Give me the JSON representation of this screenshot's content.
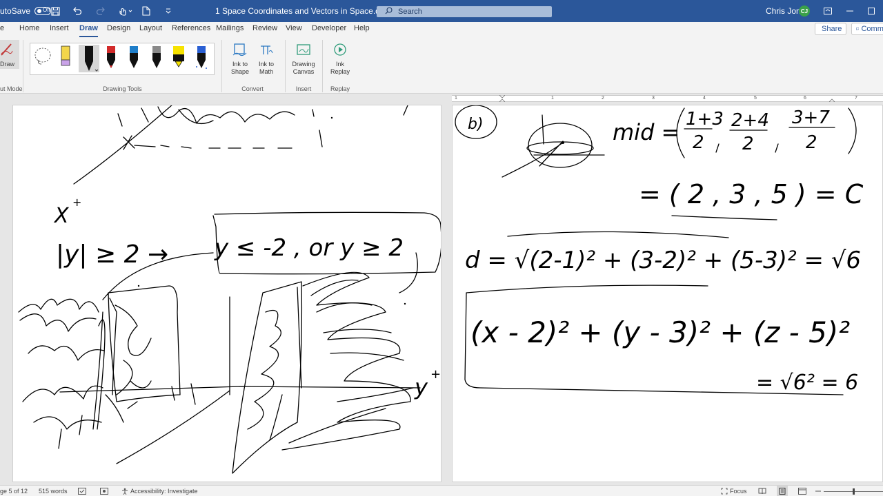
{
  "titlebar": {
    "autosave_label": "utoSave",
    "autosave_state": "Off",
    "doc_title": "1 Space Coordinates and Vectors in Space.docx",
    "search_placeholder": "Search",
    "user_name": "Chris Jones",
    "user_initials": "CJ",
    "icons": [
      "save-icon",
      "undo-icon",
      "redo-icon",
      "touch-mode-icon",
      "new-document-icon",
      "customize-toolbar-icon",
      "ribbon-display-icon",
      "minimize-icon",
      "restore-icon"
    ]
  },
  "tabs": {
    "items": [
      "e",
      "Home",
      "Insert",
      "Draw",
      "Design",
      "Layout",
      "References",
      "Mailings",
      "Review",
      "View",
      "Developer",
      "Help"
    ],
    "active": "Draw",
    "share_label": "Share",
    "comments_label": "Comme"
  },
  "ribbon": {
    "draw_label": "Draw",
    "mode_label": "ut Mode",
    "drawing_tools_label": "Drawing Tools",
    "convert_label": "Convert",
    "insert_label": "Insert",
    "replay_label": "Replay",
    "ink_to_shape_l1": "Ink to",
    "ink_to_shape_l2": "Shape",
    "ink_to_math_l1": "Ink to",
    "ink_to_math_l2": "Math",
    "drawing_canvas_l1": "Drawing",
    "drawing_canvas_l2": "Canvas",
    "ink_replay_l1": "Ink",
    "ink_replay_l2": "Replay",
    "pen_colors": [
      "#f2d64b",
      "#111111",
      "#d22a2a",
      "#1f7ec9",
      "#8a8a8a",
      "#f7e300",
      "#2a5fd3"
    ]
  },
  "ruler": {
    "numbers": [
      "1",
      "1",
      "2",
      "3",
      "4",
      "5",
      "6",
      "7"
    ]
  },
  "handwriting": {
    "left_axis_x": "X",
    "left_axis_x_sup": "+",
    "left_eq1": "|y| ≥ 2 →",
    "left_eq2": "y ≤ -2 , or   y ≥ 2",
    "left_axis_y": "y",
    "left_axis_y_sup": "+",
    "right_label_b": "b)",
    "right_mid": "mid =",
    "right_mid_frac1_num": "1+3",
    "right_mid_frac2_num": "2+4",
    "right_mid_frac3_num": "3+7",
    "right_den": "2",
    "right_result": "= ( 2 , 3 , 5 ) = C",
    "right_d": "d = √(2-1)² + (3-2)² + (5-3)² = √6",
    "right_sphere": "(x - 2)² + (y - 3)² + (z - 5)²",
    "right_sphere_rhs": "= √6² = 6"
  },
  "statusbar": {
    "page": "ge 5 of 12",
    "words": "515 words",
    "accessibility": "Accessibility: Investigate",
    "focus": "Focus"
  }
}
